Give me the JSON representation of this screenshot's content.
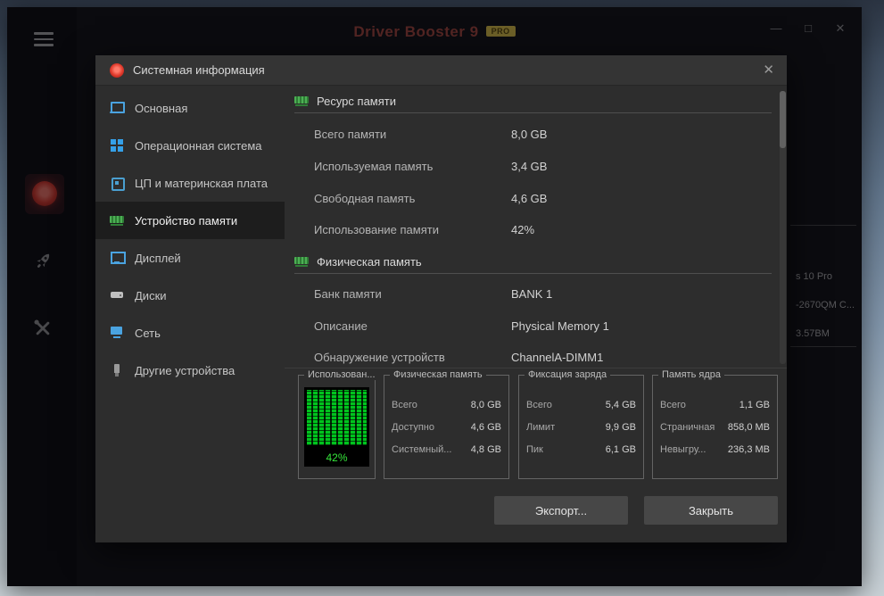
{
  "icons": {
    "minimize": "—",
    "maximize": "□",
    "close": "✕",
    "dialog_close": "✕"
  },
  "window": {
    "title": "Driver Booster 9",
    "pro_badge": "PRO",
    "bg_info_lines": [
      "s 10 Pro",
      "-2670QM C...",
      "3.57BM"
    ]
  },
  "dialog": {
    "title": "Системная информация",
    "nav": [
      {
        "label": "Основная"
      },
      {
        "label": "Операционная система"
      },
      {
        "label": "ЦП и материнская плата"
      },
      {
        "label": "Устройство памяти"
      },
      {
        "label": "Дисплей"
      },
      {
        "label": "Диски"
      },
      {
        "label": "Сеть"
      },
      {
        "label": "Другие устройства"
      }
    ],
    "sections": [
      {
        "title": "Ресурс памяти",
        "rows": [
          {
            "label": "Всего памяти",
            "value": "8,0 GB"
          },
          {
            "label": "Используемая память",
            "value": "3,4 GB"
          },
          {
            "label": "Свободная память",
            "value": "4,6 GB"
          },
          {
            "label": "Использование памяти",
            "value": "42%"
          }
        ]
      },
      {
        "title": "Физическая память",
        "rows": [
          {
            "label": "Банк памяти",
            "value": "BANK 1"
          },
          {
            "label": "Описание",
            "value": "Physical Memory 1"
          },
          {
            "label": "Обнаружение устройств",
            "value": "ChannelA-DIMM1"
          }
        ]
      }
    ],
    "stats_groups": [
      {
        "legend": "Использован...",
        "percent": "42%"
      },
      {
        "legend": "Физическая память",
        "rows": [
          {
            "label": "Всего",
            "value": "8,0 GB"
          },
          {
            "label": "Доступно",
            "value": "4,6 GB"
          },
          {
            "label": "Системный...",
            "value": "4,8 GB"
          }
        ]
      },
      {
        "legend": "Фиксация заряда",
        "rows": [
          {
            "label": "Всего",
            "value": "5,4 GB"
          },
          {
            "label": "Лимит",
            "value": "9,9 GB"
          },
          {
            "label": "Пик",
            "value": "6,1 GB"
          }
        ]
      },
      {
        "legend": "Память ядра",
        "rows": [
          {
            "label": "Всего",
            "value": "1,1 GB"
          },
          {
            "label": "Страничная",
            "value": "858,0 MB"
          },
          {
            "label": "Невыгру...",
            "value": "236,3 MB"
          }
        ]
      }
    ],
    "buttons": {
      "export": "Экспорт...",
      "close": "Закрыть"
    }
  },
  "colors": {
    "accent_green": "#00c41e",
    "logo_red": "#e03a2c",
    "pro_yellow": "#e8cc4a",
    "windows_blue": "#35a0e8"
  }
}
